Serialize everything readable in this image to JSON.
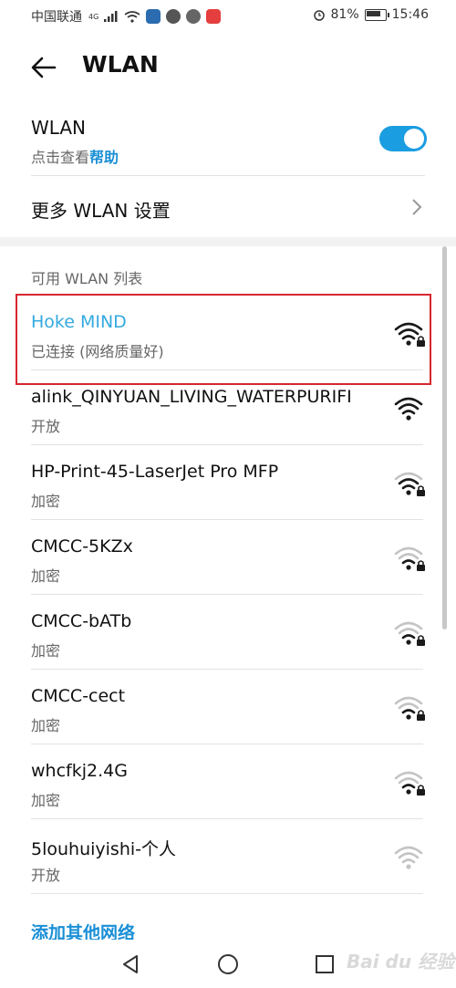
{
  "status_bar": {
    "carrier": "中国联通",
    "network_type": "4G",
    "battery": "81%",
    "time": "15:46"
  },
  "header": {
    "title": "WLAN"
  },
  "wlan_toggle": {
    "label": "WLAN",
    "hint_prefix": "点击查看",
    "help_link": "帮助",
    "enabled": true
  },
  "more_settings": {
    "label": "更多 WLAN 设置"
  },
  "network_list": {
    "title": "可用 WLAN 列表",
    "items": [
      {
        "name": "Hoke MIND",
        "status": "已连接 (网络质量好)",
        "secured": true,
        "signal": 4,
        "connected": true
      },
      {
        "name": "alink_QINYUAN_LIVING_WATERPURIFI",
        "status": "开放",
        "secured": false,
        "signal": 4,
        "connected": false
      },
      {
        "name": "HP-Print-45-LaserJet Pro MFP",
        "status": "加密",
        "secured": true,
        "signal": 3,
        "connected": false
      },
      {
        "name": "CMCC-5KZx",
        "status": "加密",
        "secured": true,
        "signal": 2,
        "connected": false
      },
      {
        "name": "CMCC-bATb",
        "status": "加密",
        "secured": true,
        "signal": 2,
        "connected": false
      },
      {
        "name": "CMCC-cect",
        "status": "加密",
        "secured": true,
        "signal": 2,
        "connected": false
      },
      {
        "name": "whcfkj2.4G",
        "status": "加密",
        "secured": true,
        "signal": 2,
        "connected": false
      },
      {
        "name": "5louhuiyishi-个人",
        "status": "开放",
        "secured": false,
        "signal": 1,
        "connected": false
      }
    ],
    "add_network": "添加其他网络"
  },
  "watermark": "Bai du 经验",
  "colors": {
    "accent": "#1a9de1",
    "link": "#1a8fd6",
    "highlight": "#d8262e"
  }
}
